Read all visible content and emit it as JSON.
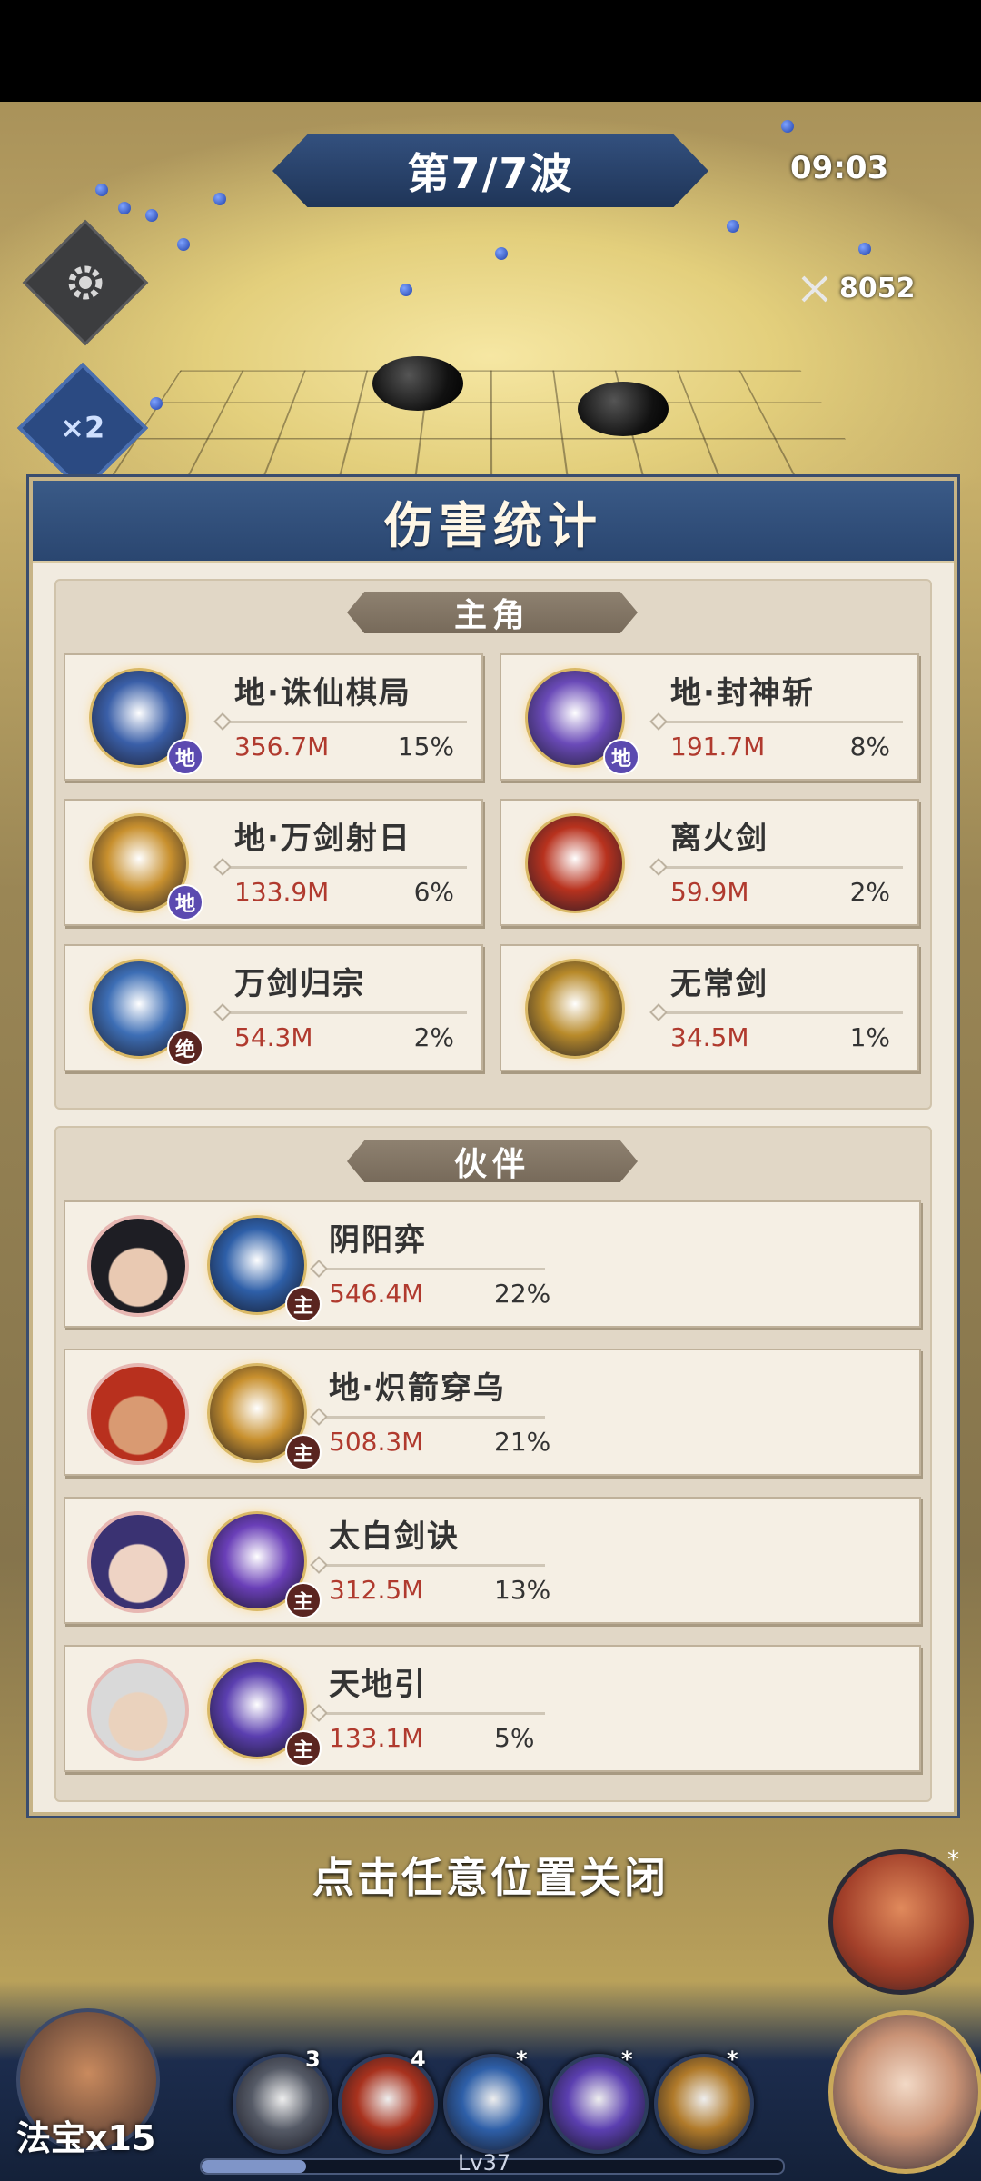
{
  "hud": {
    "wave": "第7/7波",
    "timer": "09:03",
    "kills": "8052",
    "speed": "×2"
  },
  "panel": {
    "title": "伤害统计",
    "protagonist": {
      "label": "主角",
      "skills": [
        {
          "name": "地·诛仙棋局",
          "damage": "356.7M",
          "percent": "15%",
          "badge": "地",
          "color": "#3a5fa8"
        },
        {
          "name": "地·封神斩",
          "damage": "191.7M",
          "percent": "8%",
          "badge": "地",
          "color": "#6a4ab8"
        },
        {
          "name": "地·万剑射日",
          "damage": "133.9M",
          "percent": "6%",
          "badge": "地",
          "color": "#c8902e"
        },
        {
          "name": "离火剑",
          "damage": "59.9M",
          "percent": "2%",
          "badge": "",
          "color": "#b8321e"
        },
        {
          "name": "万剑归宗",
          "damage": "54.3M",
          "percent": "2%",
          "badge": "绝",
          "color": "#3d6eb5"
        },
        {
          "name": "无常剑",
          "damage": "34.5M",
          "percent": "1%",
          "badge": "",
          "color": "#b88a2a"
        }
      ]
    },
    "partners": {
      "label": "伙伴",
      "rows": [
        {
          "skill": "阴阳弈",
          "damage": "546.4M",
          "percent": "22%",
          "badge": "主",
          "skin": "#e9c9b2",
          "hair": "#1e1e24",
          "skill_color": "#2e5fa8"
        },
        {
          "skill": "地·炽箭穿乌",
          "damage": "508.3M",
          "percent": "21%",
          "badge": "主",
          "skin": "#d99a72",
          "hair": "#b8301e",
          "skill_color": "#c8902e"
        },
        {
          "skill": "太白剑诀",
          "damage": "312.5M",
          "percent": "13%",
          "badge": "主",
          "skin": "#eed3c4",
          "hair": "#3a3272",
          "skill_color": "#6a3fb8"
        },
        {
          "skill": "天地引",
          "damage": "133.1M",
          "percent": "5%",
          "badge": "主",
          "skin": "#ead2bd",
          "hair": "#d9d9d9",
          "skill_color": "#5b3fb0"
        }
      ]
    }
  },
  "close_hint": "点击任意位置关闭",
  "bottom": {
    "fabao_label": "法宝x15",
    "slots": [
      {
        "count": "3",
        "color": "#555a66"
      },
      {
        "count": "4",
        "color": "#a8321e"
      },
      {
        "count": "*",
        "color": "#2e5fa8"
      },
      {
        "count": "*",
        "color": "#5b3fb0"
      },
      {
        "count": "*",
        "color": "#b07a2a"
      }
    ],
    "level": "Lv37",
    "portrait_star": "*"
  }
}
